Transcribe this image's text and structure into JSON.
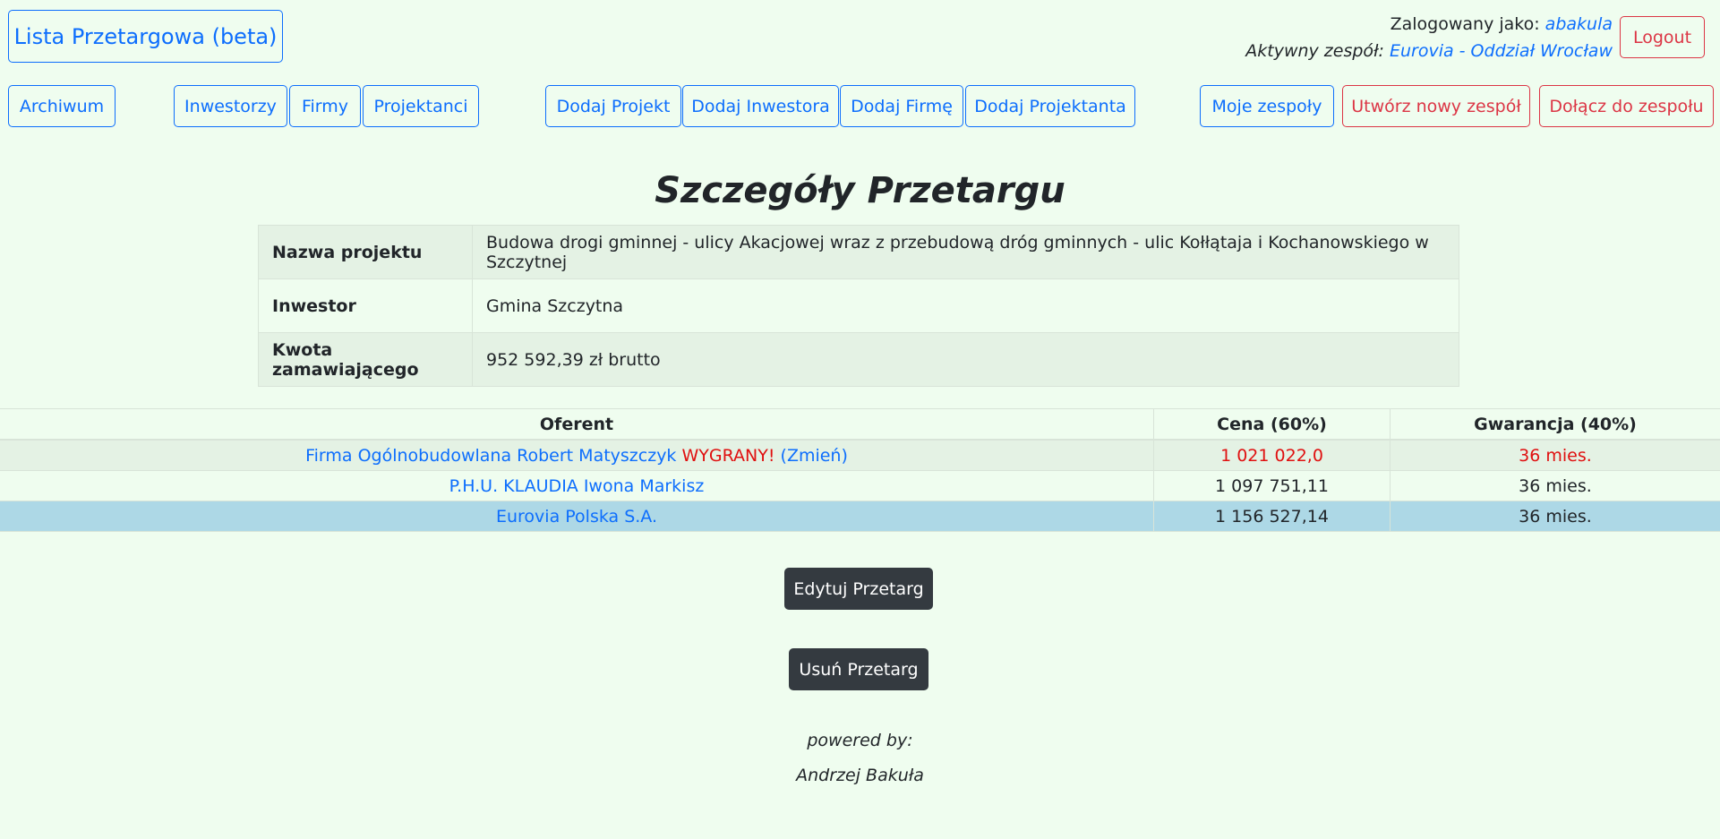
{
  "brand": "Lista Przetargowa (beta)",
  "user": {
    "logged_in_label": "Zalogowany jako:",
    "username": "abakula",
    "team_label": "Aktywny zespół:",
    "team_name": "Eurovia - Oddział Wrocław",
    "logout": "Logout"
  },
  "nav": {
    "archive": "Archiwum",
    "investors": "Inwestorzy",
    "companies": "Firmy",
    "designers": "Projektanci",
    "add_project": "Dodaj Projekt",
    "add_investor": "Dodaj Inwestora",
    "add_company": "Dodaj Firmę",
    "add_designer": "Dodaj Projektanta",
    "my_teams": "Moje zespoły",
    "create_team": "Utwórz nowy zespół",
    "join_team": "Dołącz do zespołu"
  },
  "page_title": "Szczegóły Przetargu",
  "details": [
    {
      "label": "Nazwa projektu",
      "value": "Budowa drogi gminnej - ulicy Akacjowej wraz z przebudową dróg gminnych - ulic Kołłątaja i Kochanowskiego w Szczytnej"
    },
    {
      "label": "Inwestor",
      "value": "Gmina Szczytna"
    },
    {
      "label": "Kwota zamawiającego",
      "value": "952 592,39 zł brutto"
    }
  ],
  "offers": {
    "headers": [
      "Oferent",
      "Cena (60%)",
      "Gwarancja (40%)"
    ],
    "rows": [
      {
        "name": "Firma Ogólnobudowlana Robert Matyszczyk",
        "winner": "WYGRANY!",
        "change": "(Zmień)",
        "price": "1 021 022,0",
        "warranty": "36 mies."
      },
      {
        "name": "P.H.U. KLAUDIA Iwona Markisz",
        "price": "1 097 751,11",
        "warranty": "36 mies."
      },
      {
        "name": "Eurovia Polska S.A.",
        "price": "1 156 527,14",
        "warranty": "36 mies."
      }
    ]
  },
  "actions": {
    "edit": "Edytuj Przetarg",
    "delete": "Usuń Przetarg"
  },
  "footer": {
    "powered_by": "powered by:",
    "author": "Andrzej Bakuła"
  }
}
